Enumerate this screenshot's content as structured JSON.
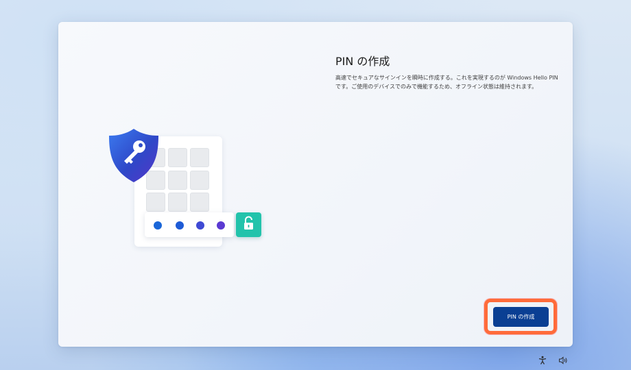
{
  "page": {
    "title": "PIN の作成",
    "description": "高速でセキュアなサインインを瞬時に作成する。これを実現するのが Windows Hello PIN です。ご使用のデバイスでのみで機能するため、オフライン状態は維持されます。"
  },
  "illustration": {
    "pin_dot_colors": [
      "#1a66d8",
      "#1e5bd6",
      "#3f4ad4",
      "#5b3ad2"
    ],
    "shield_colors": [
      "#3b7bf0",
      "#2f48c8",
      "#5535c8"
    ],
    "lock_badge_color": "#22c3ab",
    "icons": [
      "shield-key-icon",
      "unlock-icon"
    ]
  },
  "actions": {
    "primary_label": "PIN の作成",
    "highlight_color": "#ff6b3a"
  },
  "system_tray": {
    "icons": [
      "accessibility-icon",
      "volume-icon"
    ]
  }
}
